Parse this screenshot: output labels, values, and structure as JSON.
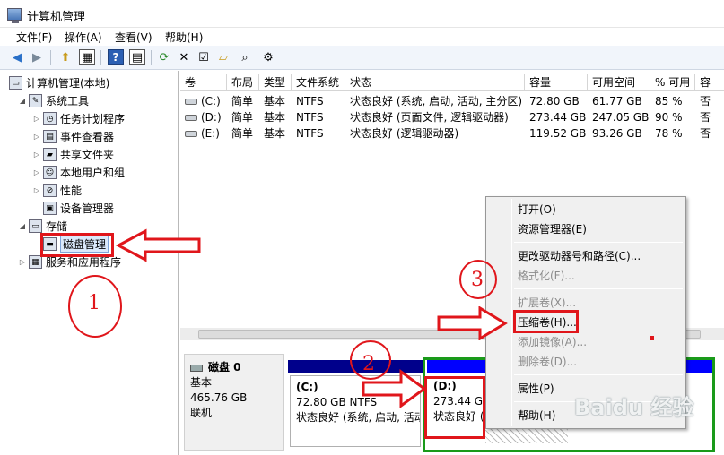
{
  "window": {
    "title": "计算机管理"
  },
  "menu": [
    "文件(F)",
    "操作(A)",
    "查看(V)",
    "帮助(H)"
  ],
  "tree": {
    "root": "计算机管理(本地)",
    "system_tools": "系统工具",
    "task_scheduler": "任务计划程序",
    "event_viewer": "事件查看器",
    "shared_folders": "共享文件夹",
    "local_users": "本地用户和组",
    "performance": "性能",
    "device_manager": "设备管理器",
    "storage": "存储",
    "disk_management": "磁盘管理",
    "services": "服务和应用程序"
  },
  "volume_table": {
    "headers": [
      "卷",
      "布局",
      "类型",
      "文件系统",
      "状态",
      "容量",
      "可用空间",
      "% 可用",
      "容"
    ],
    "rows": [
      [
        "(C:)",
        "简单",
        "基本",
        "NTFS",
        "状态良好 (系统, 启动, 活动, 主分区)",
        "72.80 GB",
        "61.77 GB",
        "85 %",
        "否"
      ],
      [
        "(D:)",
        "简单",
        "基本",
        "NTFS",
        "状态良好 (页面文件, 逻辑驱动器)",
        "273.44 GB",
        "247.05 GB",
        "90 %",
        "否"
      ],
      [
        "(E:)",
        "简单",
        "基本",
        "NTFS",
        "状态良好 (逻辑驱动器)",
        "119.52 GB",
        "93.26 GB",
        "78 %",
        "否"
      ]
    ]
  },
  "disk": {
    "name": "磁盘 0",
    "type": "基本",
    "size": "465.76 GB",
    "status": "联机",
    "partitions": [
      {
        "label": "(C:)",
        "size": "72.80 GB NTFS",
        "status": "状态良好 (系统, 启动, 活动"
      },
      {
        "label": "(D:)",
        "size": "273.44 GB",
        "status": "状态良好 ("
      }
    ]
  },
  "context_menu": {
    "open": "打开(O)",
    "explore": "资源管理器(E)",
    "change_letter": "更改驱动器号和路径(C)...",
    "format": "格式化(F)...",
    "extend": "扩展卷(X)...",
    "shrink": "压缩卷(H)...",
    "add_mirror": "添加镜像(A)...",
    "delete": "删除卷(D)...",
    "properties": "属性(P)",
    "help": "帮助(H)"
  },
  "annotations": {
    "step1": "1",
    "step2": "2",
    "step3": "3"
  },
  "watermark": "Baidu 经验",
  "colors": {
    "annotation_red": "#e0161b",
    "partition_primary": "#00008b",
    "partition_logical": "#0000ff",
    "selection_green": "#1a9a1a"
  }
}
